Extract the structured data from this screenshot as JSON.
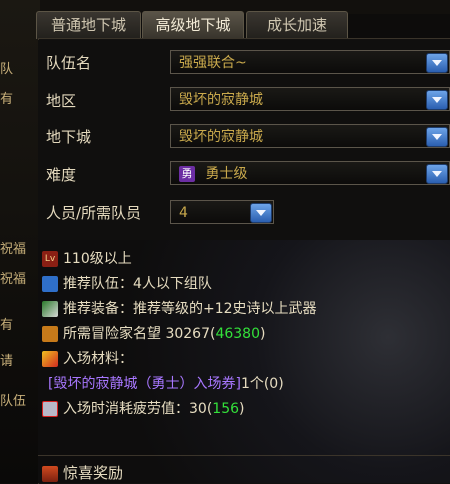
{
  "tabs": [
    "普通地下城",
    "高级地下城",
    "成长加速"
  ],
  "form": {
    "team_name_label": "队伍名",
    "team_name_value": "强强联合~",
    "region_label": "地区",
    "region_value": "毁坏的寂静城",
    "dungeon_label": "地下城",
    "dungeon_value": "毁坏的寂静城",
    "difficulty_label": "难度",
    "difficulty_badge": "勇",
    "difficulty_value": "勇士级",
    "members_label": "人员/所需队员",
    "members_value": "4"
  },
  "info": {
    "level": "110级以上",
    "recommended_team": "推荐队伍：4人以下组队",
    "recommended_gear": "推荐装备：推荐等级的+12史诗以上武器",
    "reputation_label": "所需冒险家名望 30267(",
    "reputation_value": "46380",
    "reputation_close": ")",
    "materials_label": "入场材料：",
    "ticket_name": "[毁坏的寂静城（勇士）入场券]",
    "ticket_count": "1个(0)",
    "fatigue_label": "入场时消耗疲劳值：30(",
    "fatigue_value": "156",
    "fatigue_close": ")",
    "reward_label": "惊喜奖励"
  },
  "background": {
    "left_items": [
      "队",
      "有",
      "祝福",
      "祝福",
      "有",
      "请",
      "队伍"
    ]
  },
  "colors": {
    "accent_blue": "#4a86d8",
    "highlight_green": "#33e03a",
    "ticket_purple": "#a877ff"
  }
}
